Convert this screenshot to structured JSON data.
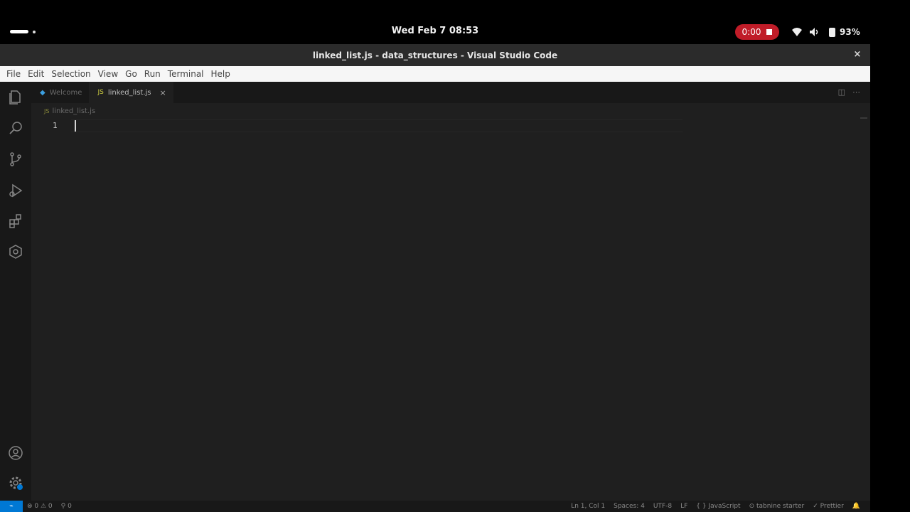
{
  "system": {
    "clock": "Wed Feb 7  08:53",
    "recording_time": "0:00",
    "battery": "93%",
    "icons": [
      "activities-icon",
      "wifi-icon",
      "volume-icon",
      "battery-icon",
      "record-stop-icon"
    ],
    "recording_color": "#c01c28"
  },
  "window": {
    "title": "linked_list.js - data_structures - Visual Studio Code",
    "close_label": "×"
  },
  "menu": [
    "File",
    "Edit",
    "Selection",
    "View",
    "Go",
    "Run",
    "Terminal",
    "Help"
  ],
  "activity_bar": {
    "items": [
      "explorer-icon",
      "search-icon",
      "source-control-icon",
      "run-debug-icon",
      "extensions-icon",
      "remote-explorer-icon"
    ],
    "bottom": [
      "accounts-icon",
      "manage-gear-icon"
    ]
  },
  "tabs": [
    {
      "label": "Welcome",
      "active": false,
      "icon": "vscode-logo-icon"
    },
    {
      "label": "linked_list.js",
      "active": true,
      "icon": "js-file-icon",
      "close": "×"
    }
  ],
  "breadcrumb": {
    "file": "linked_list.js"
  },
  "editor": {
    "line_numbers": [
      "1"
    ],
    "content": ""
  },
  "statusbar": {
    "remote": "⌁",
    "problems": "⊗ 0 ⚠ 0",
    "ports": "⚲ 0",
    "position": "Ln 1, Col 1",
    "spaces": "Spaces: 4",
    "encoding": "UTF-8",
    "eol": "LF",
    "language": "{ } JavaScript",
    "tabnine": "⊙ tabnine starter",
    "prettier": "✓ Prettier",
    "notifications": "🔔"
  },
  "colors": {
    "accent": "#0078d4",
    "editor_bg": "#1f1f1f",
    "menubar_bg": "#f6f6f6"
  }
}
